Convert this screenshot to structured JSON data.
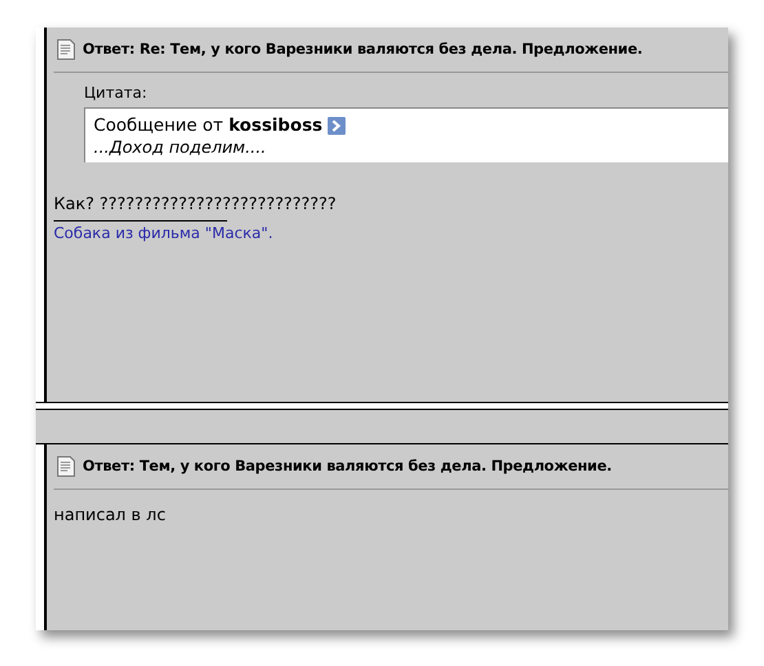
{
  "posts": [
    {
      "title": "Ответ: Re: Тем, у кого Варезники валяются без дела. Предложение.",
      "quote": {
        "label": "Цитата:",
        "source": "Сообщение от **kossiboss**",
        "text": "...Доход поделим...."
      },
      "body": "Как? ???????????????????????????",
      "signature": "Собака из фильма \"Маска\"."
    },
    {
      "title": "Ответ: Тем, у кого Варезники валяются без дела. Предложение.",
      "body": "написал в лс"
    }
  ]
}
